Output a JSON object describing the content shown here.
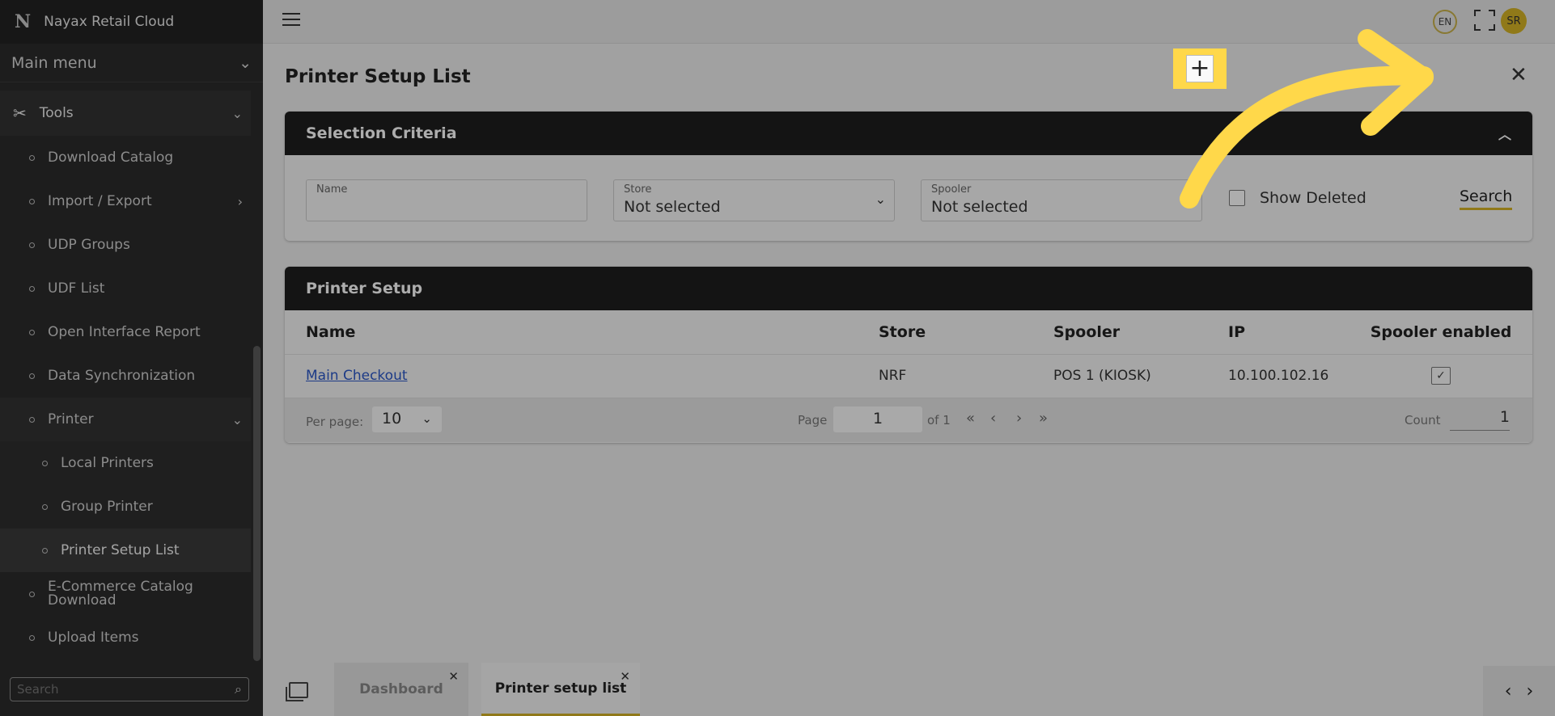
{
  "brand": {
    "logo": "N",
    "name": "Nayax Retail Cloud"
  },
  "sidebar": {
    "main_menu_label": "Main menu",
    "items": [
      {
        "label": "Tools",
        "type": "group"
      },
      {
        "label": "Download Catalog",
        "type": "l1"
      },
      {
        "label": "Import / Export",
        "type": "l1"
      },
      {
        "label": "UDP Groups",
        "type": "l1"
      },
      {
        "label": "UDF List",
        "type": "l1"
      },
      {
        "label": "Open Interface Report",
        "type": "l1"
      },
      {
        "label": "Data Synchronization",
        "type": "l1"
      },
      {
        "label": "Printer",
        "type": "l1"
      },
      {
        "label": "Local Printers",
        "type": "l2"
      },
      {
        "label": "Group Printer",
        "type": "l2"
      },
      {
        "label": "Printer Setup List",
        "type": "l2"
      },
      {
        "label": "E-Commerce Catalog Download",
        "type": "l1"
      },
      {
        "label": "Upload Items",
        "type": "l1"
      }
    ],
    "search_placeholder": "Search"
  },
  "topbar": {
    "lang": "EN",
    "avatar_initials": "SR"
  },
  "page": {
    "title": "Printer Setup List"
  },
  "criteria": {
    "title": "Selection Criteria",
    "name_label": "Name",
    "name_value": "",
    "store_label": "Store",
    "store_value": "Not selected",
    "spooler_label": "Spooler",
    "spooler_value": "Not selected",
    "show_deleted_label": "Show Deleted",
    "search_label": "Search"
  },
  "grid": {
    "title": "Printer Setup",
    "columns": [
      "Name",
      "Store",
      "Spooler",
      "IP",
      "Spooler enabled"
    ],
    "rows": [
      {
        "name": "Main Checkout",
        "store": "NRF",
        "spooler": "POS 1 (KIOSK)",
        "ip": "10.100.102.16",
        "enabled": true
      }
    ],
    "per_page_label": "Per page:",
    "per_page_value": "10",
    "page_label": "Page",
    "page_value": "1",
    "of_label": "of 1",
    "count_label": "Count",
    "count_value": "1"
  },
  "tabs": [
    {
      "label": "Dashboard",
      "active": false
    },
    {
      "label": "Printer setup list",
      "active": true
    }
  ],
  "colors": {
    "accent": "#d4b325",
    "highlight": "#ffd84a",
    "header_dark": "#1e1e1e",
    "sidebar": "#2b2b2b",
    "link": "#2b57c7"
  }
}
